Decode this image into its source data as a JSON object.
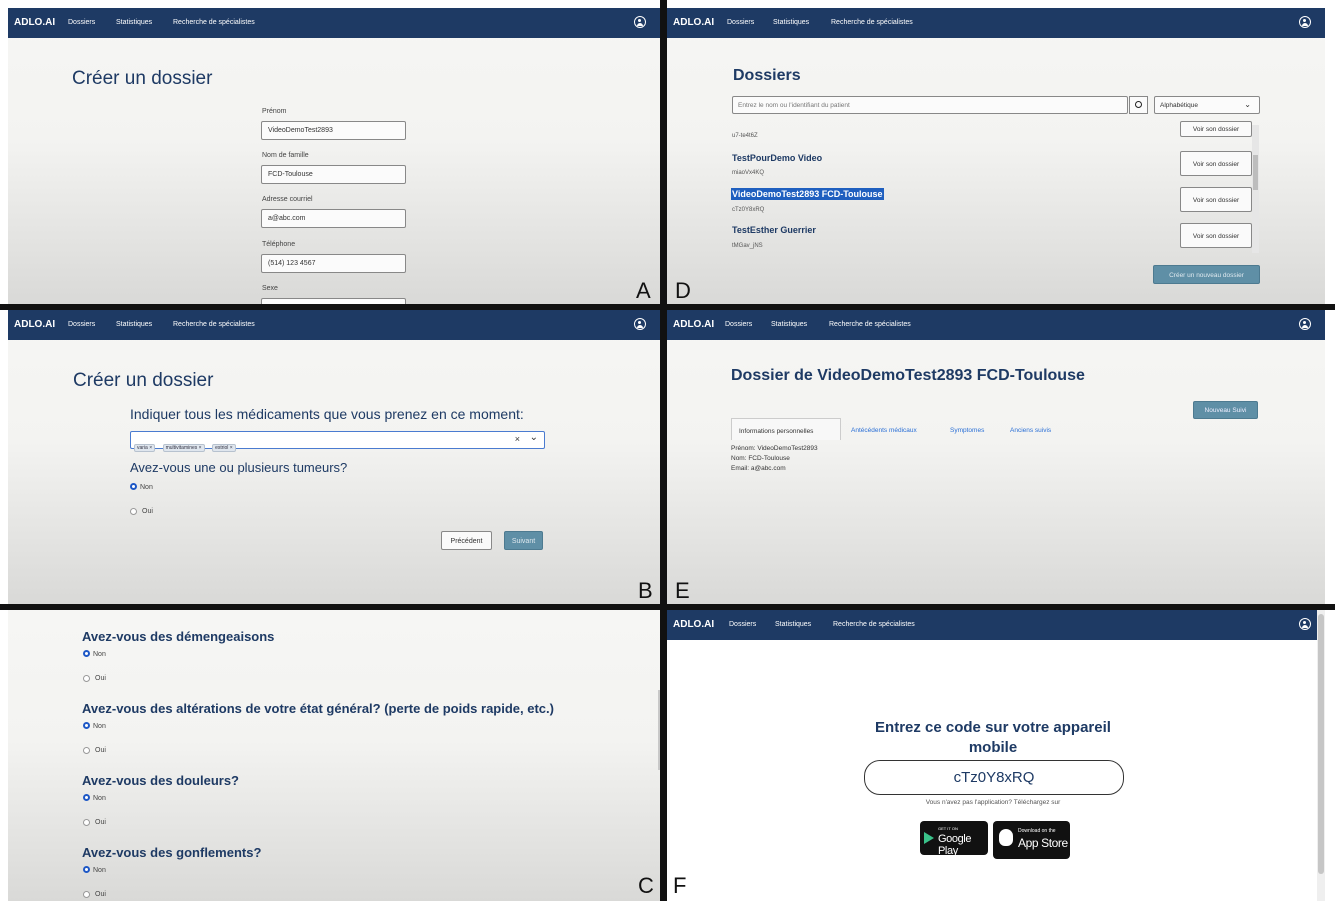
{
  "nav": {
    "brand": "ADLO.AI",
    "links": [
      "Dossiers",
      "Statistiques",
      "Recherche de spécialistes"
    ],
    "account_icon": "user-circle-icon"
  },
  "labels": [
    "A",
    "B",
    "C",
    "D",
    "E",
    "F"
  ],
  "panelA": {
    "title": "Créer un dossier",
    "fields": [
      {
        "label": "Prénom",
        "value": "VideoDemoTest2893"
      },
      {
        "label": "Nom de famille",
        "value": "FCD-Toulouse"
      },
      {
        "label": "Adresse courriel",
        "value": "a@abc.com"
      },
      {
        "label": "Téléphone",
        "value": "(514) 123 4567"
      },
      {
        "label": "Sexe",
        "value": ""
      }
    ]
  },
  "panelB": {
    "title": "Créer un dossier",
    "question_meds": "Indiquer tous les médicaments que vous prenez en ce moment:",
    "meds": [
      "varia",
      "multivitamines",
      "estriol"
    ],
    "question_tumors": "Avez-vous une ou plusieurs tumeurs?",
    "option_no": "Non",
    "option_yes": "Oui",
    "prev_label": "Précédent",
    "next_label": "Suivant"
  },
  "panelC": {
    "questions": [
      "Avez-vous des démengeaisons",
      "Avez-vous des altérations de votre état général? (perte de poids rapide, etc.)",
      "Avez-vous des douleurs?",
      "Avez-vous des gonflements?"
    ],
    "option_no": "Non",
    "option_yes": "Oui"
  },
  "panelD": {
    "title": "Dossiers",
    "search_placeholder": "Entrez le nom ou l'identifiant du patient",
    "sort_value": "Alphabétique",
    "first_id": "u7-te4t6Z",
    "patients": [
      {
        "name": "TestPourDemo Video",
        "id": "miaoVx4KQ"
      },
      {
        "name": "VideoDemoTest2893 FCD-Toulouse",
        "id": "cTz0Y8xRQ"
      },
      {
        "name": "TestEsther Guerrier",
        "id": "tMGav_jNS"
      }
    ],
    "view_label": "Voir son dossier",
    "create_label": "Créer un nouveau dossier"
  },
  "panelE": {
    "title": "Dossier de VideoDemoTest2893 FCD-Toulouse",
    "new_followup": "Nouveau Suivi",
    "tabs": [
      "Informations personnelles",
      "Antécédents médicaux",
      "Symptomes",
      "Anciens suivis"
    ],
    "info": [
      "Prénom: VideoDemoTest2893",
      "Nom: FCD-Toulouse",
      "Email: a@abc.com"
    ]
  },
  "panelF": {
    "title_line1": "Entrez ce code sur votre appareil",
    "title_line2": "mobile",
    "code": "cTz0Y8xRQ",
    "subtitle": "Vous n'avez pas l'application? Téléchargez sur",
    "google_small": "GET IT ON",
    "google_big": "Google Play",
    "apple_small": "Download on the",
    "apple_big": "App Store"
  }
}
